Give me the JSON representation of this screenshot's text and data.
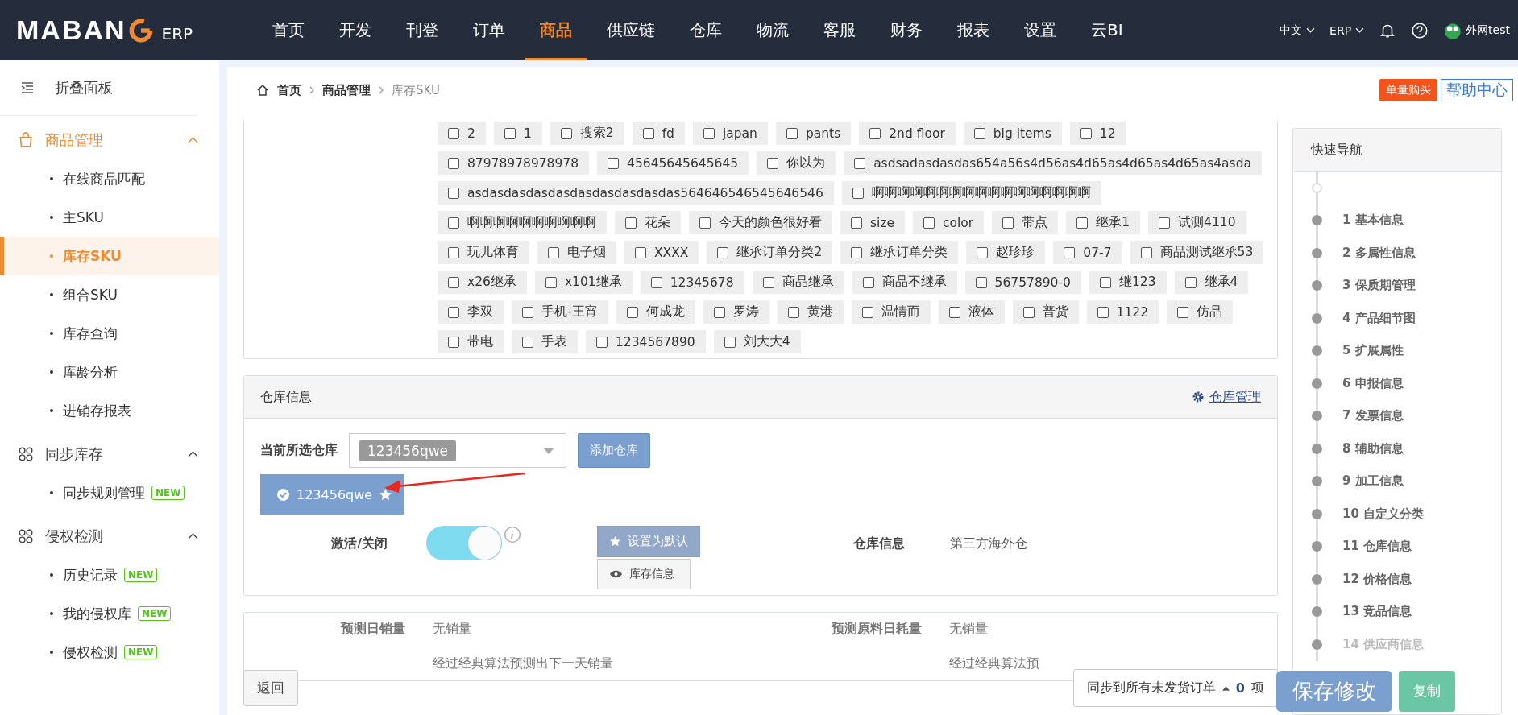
{
  "header": {
    "logo": "MABAN",
    "logo_suffix": "ERP",
    "nav": [
      {
        "label": "首页",
        "selected": false
      },
      {
        "label": "开发",
        "selected": false
      },
      {
        "label": "刊登",
        "selected": false
      },
      {
        "label": "订单",
        "selected": false
      },
      {
        "label": "商品",
        "selected": true
      },
      {
        "label": "供应链",
        "selected": false
      },
      {
        "label": "仓库",
        "selected": false
      },
      {
        "label": "物流",
        "selected": false
      },
      {
        "label": "客服",
        "selected": false
      },
      {
        "label": "财务",
        "selected": false
      },
      {
        "label": "报表",
        "selected": false
      },
      {
        "label": "设置",
        "selected": false
      },
      {
        "label": "云BI",
        "selected": false
      }
    ],
    "language": "中文",
    "system": "ERP",
    "user": "外网test"
  },
  "sidebar": {
    "collapse": "折叠面板",
    "groups": [
      {
        "label": "商品管理",
        "kind": "bag",
        "expanded": true,
        "selected": true,
        "items": [
          {
            "label": "在线商品匹配",
            "selected": false
          },
          {
            "label": "主SKU",
            "selected": false
          },
          {
            "label": "库存SKU",
            "selected": true
          },
          {
            "label": "组合SKU",
            "selected": false
          },
          {
            "label": "库存查询",
            "selected": false
          },
          {
            "label": "库龄分析",
            "selected": false
          },
          {
            "label": "进销存报表",
            "selected": false
          }
        ]
      },
      {
        "label": "同步库存",
        "kind": "grid",
        "expanded": true,
        "selected": false,
        "items": [
          {
            "label": "同步规则管理",
            "selected": false,
            "badge": "NEW"
          }
        ]
      },
      {
        "label": "侵权检测",
        "kind": "grid",
        "expanded": true,
        "selected": false,
        "items": [
          {
            "label": "历史记录",
            "selected": false,
            "badge": "NEW"
          },
          {
            "label": "我的侵权库",
            "selected": false,
            "badge": "NEW"
          },
          {
            "label": "侵权检测",
            "selected": false,
            "badge": "NEW"
          }
        ]
      }
    ]
  },
  "breadcrumb": [
    "首页",
    "商品管理",
    "库存SKU"
  ],
  "top_buttons": [
    "单量购买",
    "帮助中心"
  ],
  "tags": [
    {
      "label": "2",
      "checked": false
    },
    {
      "label": "1",
      "checked": false
    },
    {
      "label": "搜索2",
      "checked": false
    },
    {
      "label": "fd",
      "checked": false
    },
    {
      "label": "japan",
      "checked": false
    },
    {
      "label": "pants",
      "checked": false
    },
    {
      "label": "2nd floor",
      "checked": false
    },
    {
      "label": "big items",
      "checked": false
    },
    {
      "label": "12",
      "checked": false
    },
    {
      "label": "87978978978978",
      "checked": false
    },
    {
      "label": "45645645645645",
      "checked": false
    },
    {
      "label": "你以为",
      "checked": false
    },
    {
      "label": "asdsadasdasdas654a56s4d56as4d65as4d65as4d65as4asda",
      "checked": false
    },
    {
      "label": "asdasdasdasdasdasdasdasdasdas564646546545646546",
      "checked": false
    },
    {
      "label": "啊啊啊啊啊啊啊啊啊啊啊啊啊啊啊啊啊",
      "checked": false
    },
    {
      "label": "啊啊啊啊啊啊啊啊啊啊",
      "checked": false
    },
    {
      "label": "花朵",
      "checked": false
    },
    {
      "label": "今天的颜色很好看",
      "checked": false
    },
    {
      "label": "size",
      "checked": false
    },
    {
      "label": "color",
      "checked": false
    },
    {
      "label": "带点",
      "checked": false
    },
    {
      "label": "继承1",
      "checked": false
    },
    {
      "label": "试测4110",
      "checked": false
    },
    {
      "label": "玩儿体育",
      "checked": false
    },
    {
      "label": "电子烟",
      "checked": false
    },
    {
      "label": "XXXX",
      "checked": false
    },
    {
      "label": "继承订单分类2",
      "checked": false
    },
    {
      "label": "继承订单分类",
      "checked": false
    },
    {
      "label": "赵珍珍",
      "checked": false
    },
    {
      "label": "07-7",
      "checked": false
    },
    {
      "label": "商品测试继承53",
      "checked": false
    },
    {
      "label": "x26继承",
      "checked": false
    },
    {
      "label": "x101继承",
      "checked": false
    },
    {
      "label": "12345678",
      "checked": false
    },
    {
      "label": "商品继承",
      "checked": false
    },
    {
      "label": "商品不继承",
      "checked": false
    },
    {
      "label": "56757890-0",
      "checked": false
    },
    {
      "label": "继123",
      "checked": false
    },
    {
      "label": "继承4",
      "checked": false
    },
    {
      "label": "李双",
      "checked": false
    },
    {
      "label": "手机-王宵",
      "checked": false
    },
    {
      "label": "何成龙",
      "checked": false
    },
    {
      "label": "罗涛",
      "checked": false
    },
    {
      "label": "黄港",
      "checked": false
    },
    {
      "label": "温情而",
      "checked": false
    },
    {
      "label": "液体",
      "checked": false
    },
    {
      "label": "普货",
      "checked": false
    },
    {
      "label": "1122",
      "checked": false
    },
    {
      "label": "仿品",
      "checked": false
    },
    {
      "label": "带电",
      "checked": false
    },
    {
      "label": "手表",
      "checked": false
    },
    {
      "label": "1234567890",
      "checked": false
    },
    {
      "label": "刘大大4",
      "checked": false
    }
  ],
  "warehouse": {
    "title": "仓库信息",
    "manage_link": "仓库管理",
    "current_label": "当前所选仓库",
    "selected_value": "123456qwe",
    "add_button": "添加仓库",
    "chip": "123456qwe",
    "toggle_label": "激活/关闭",
    "active": true,
    "default_button": "设置为默认",
    "stock_button": "库存信息",
    "info_label": "仓库信息",
    "info_value": "第三方海外仓"
  },
  "forecast": [
    {
      "label": "预测日销量",
      "value": "无销量",
      "note": "经过经典算法预测出下一天销量"
    },
    {
      "label": "预测原料日耗量",
      "value": "无销量",
      "note": "经过经典算法预"
    }
  ],
  "footer": {
    "back": "返回",
    "sync": "同步到所有未发货订单",
    "count": "0",
    "unit": "项",
    "save": "保存修改",
    "copy": "复制"
  },
  "quick_nav": {
    "title": "快速导航",
    "items": [
      "1 基本信息",
      "2 多属性信息",
      "3 保质期管理",
      "4 产品细节图",
      "5 扩展属性",
      "6 申报信息",
      "7 发票信息",
      "8 辅助信息",
      "9 加工信息",
      "10 自定义分类",
      "11 仓库信息",
      "12 价格信息",
      "13 竞品信息",
      "14 供应商信息"
    ]
  }
}
